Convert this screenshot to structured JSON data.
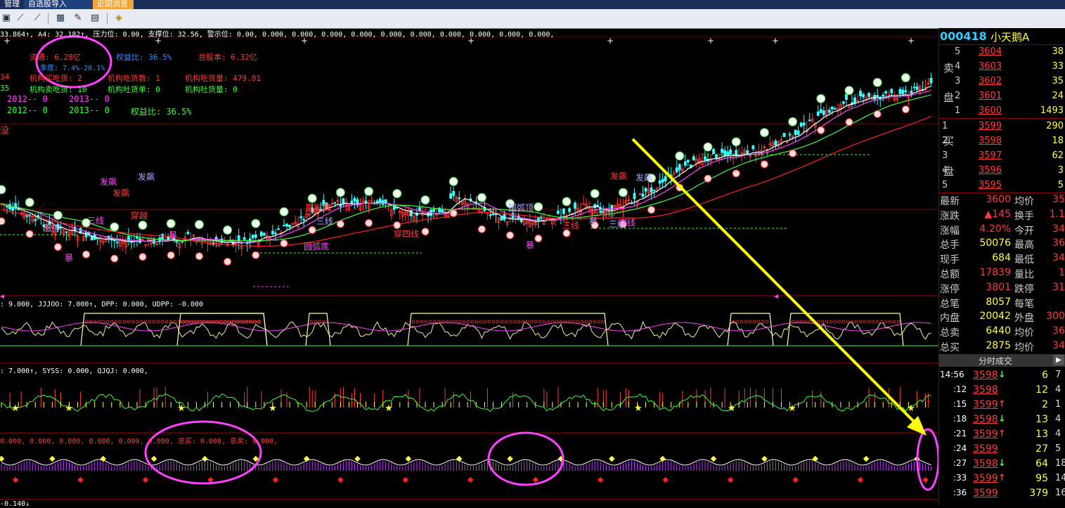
{
  "tabs": [
    {
      "label": "管理",
      "active": false
    },
    {
      "label": "自选股导入",
      "active": false
    },
    {
      "label": "近期浏览",
      "active": true
    }
  ],
  "toolbar": {
    "icons": [
      "chart-icon",
      "draw-line-icon",
      "draw-tool-icon",
      "grid-icon",
      "note-icon",
      "stats-icon",
      "diamond-nav-icon"
    ]
  },
  "indicator_main": {
    "text": "33.864↑, A4: 32.182↑, 压力位: 0.00, 支撑位: 32.56, 警示位: 0.00, 0.000, 0.000, 0.000, 0.000, 0.000, 0.000, 0.000, 0.000, 0.000, 0.000,",
    "info": {
      "liutong": "流通: 6.28亿",
      "jigou_buy": "机构买吃货: 2",
      "jigou_sell": "机构卖吃货: 10",
      "quanyi_top": "权益比: 36.5%",
      "jigou_chihuo": "机构吃货数: 1",
      "jigou_tuohuo": "机构吐货单: 0",
      "zongguben": "总股本: 6.32亿",
      "jigou_chiliang": "机构吃货量: 479.01",
      "jigou_tuoliang": "机构吐货量: 0",
      "jidu": "季度: 7.4%-28.1%",
      "left1": "34",
      "left2": "35",
      "y2012a": "2012-- 0",
      "y2013a": "2013-- 0",
      "y2012b": "2012-- 0",
      "y2013b": "2013-- 0",
      "quanyi": "权益比: 36.5%"
    },
    "labels": [
      "发飙",
      "发飙",
      "发飙",
      "三线",
      "穿越",
      "涨停",
      "暴",
      "星发飙",
      "三线",
      "暴",
      "穿四线",
      "圆弧顶",
      "圆弧底",
      "发飙",
      "发飙",
      "暴",
      "三线",
      "暴",
      "穿线",
      "进站台",
      "三线"
    ],
    "misc": "没"
  },
  "indicator2": {
    "text": ": 9.000, JJJOO: 7.000↑, DPP: 0.000, UDPP: -0.000"
  },
  "indicator3": {
    "text": ": 7.000↑, SYSS: 0.000, QJQJ: 0.000,"
  },
  "indicator4": {
    "text": "0.000, 0.000, 0.000, 0.000, 0.000, 0.000, 总买: 0.000, 总卖: 0.000,"
  },
  "bottom_text": "-0.140↓",
  "stock": {
    "code": "000418",
    "name": "小天鹅A"
  },
  "sell_side_label": [
    "卖",
    "盘"
  ],
  "buy_side_label": [
    "买",
    "盘"
  ],
  "sell_orders": [
    {
      "level": "5",
      "price": "3604",
      "vol": "38"
    },
    {
      "level": "4",
      "price": "3603",
      "vol": "33"
    },
    {
      "level": "3",
      "price": "3602",
      "vol": "35"
    },
    {
      "level": "2",
      "price": "3601",
      "vol": "24"
    },
    {
      "level": "1",
      "price": "3600",
      "vol": "1493"
    }
  ],
  "buy_orders": [
    {
      "level": "1",
      "price": "3599",
      "vol": "290"
    },
    {
      "level": "2",
      "price": "3598",
      "vol": "18"
    },
    {
      "level": "3",
      "price": "3597",
      "vol": "62"
    },
    {
      "level": "4",
      "price": "3596",
      "vol": "3"
    },
    {
      "level": "5",
      "price": "3595",
      "vol": "5"
    }
  ],
  "quote": [
    {
      "label": "最新",
      "value": "3600",
      "label2": "均价",
      "value2": "35"
    },
    {
      "label": "涨跌",
      "value": "▲145",
      "label2": "换手",
      "value2": "1.1"
    },
    {
      "label": "涨幅",
      "value": "4.20%",
      "label2": "今开",
      "value2": "34"
    },
    {
      "label": "总手",
      "value": "50076",
      "label2": "最高",
      "value2": "36"
    },
    {
      "label": "现手",
      "value": "684",
      "label2": "最低",
      "value2": "34"
    },
    {
      "label": "总额",
      "value": "17839",
      "label2": "量比",
      "value2": "1"
    },
    {
      "label": "涨停",
      "value": "3801",
      "label2": "跌停",
      "value2": "31"
    },
    {
      "label": "总笔",
      "value": "8057",
      "label2": "每笔",
      "value2": ""
    },
    {
      "label": "内盘",
      "value": "20042",
      "label2": "外盘",
      "value2": "300"
    },
    {
      "label": "总卖",
      "value": "6440",
      "label2": "均价",
      "value2": "36"
    },
    {
      "label": "总买",
      "value": "2875",
      "label2": "均价",
      "value2": "34"
    }
  ],
  "trades_header": "分时成交",
  "trades": [
    {
      "time": "14:56",
      "price": "3598",
      "dir": "↓",
      "vol": "6",
      "x": "7"
    },
    {
      "time": ":12",
      "price": "3598",
      "dir": "",
      "vol": "12",
      "x": "4"
    },
    {
      "time": ":15",
      "price": "3599",
      "dir": "↑",
      "vol": "2",
      "x": "1"
    },
    {
      "time": ":18",
      "price": "3598",
      "dir": "↓",
      "vol": "13",
      "x": "4"
    },
    {
      "time": ":21",
      "price": "3599",
      "dir": "↑",
      "vol": "13",
      "x": "4"
    },
    {
      "time": ":24",
      "price": "3599",
      "dir": "",
      "vol": "27",
      "x": "5"
    },
    {
      "time": ":27",
      "price": "3598",
      "dir": "↓",
      "vol": "64",
      "x": "18"
    },
    {
      "time": ":33",
      "price": "3599",
      "dir": "↑",
      "vol": "95",
      "x": "14"
    },
    {
      "time": ":36",
      "price": "3599",
      "dir": "",
      "vol": "379",
      "x": "16"
    }
  ],
  "colors": {
    "red": "#ff3c3c",
    "yellow": "#ffff3c",
    "green": "#3cff3c",
    "magenta": "#ff44ff",
    "cyan": "#33ccff"
  }
}
